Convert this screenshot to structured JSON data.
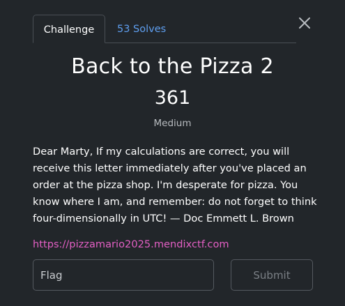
{
  "tabs": [
    {
      "label": "Challenge",
      "active": true
    },
    {
      "label": "53 Solves",
      "active": false
    }
  ],
  "close_icon": "close-icon",
  "challenge": {
    "title": "Back to the Pizza 2",
    "points": "361",
    "difficulty": "Medium",
    "description": "Dear Marty, If my calculations are correct, you will receive this letter immediately after you've placed an order at the pizza shop. I'm desperate for pizza. You know where I am, and remember: do not forget to think four-dimensionally in UTC! — Doc Emmett L. Brown",
    "link": "https://pizzamario2025.mendixctf.com"
  },
  "form": {
    "flag_placeholder": "Flag",
    "flag_value": "",
    "submit_label": "Submit"
  },
  "colors": {
    "background": "#22262a",
    "link": "#e35fc4",
    "tab_link": "#5f9ff0",
    "border": "#4a4f55"
  }
}
